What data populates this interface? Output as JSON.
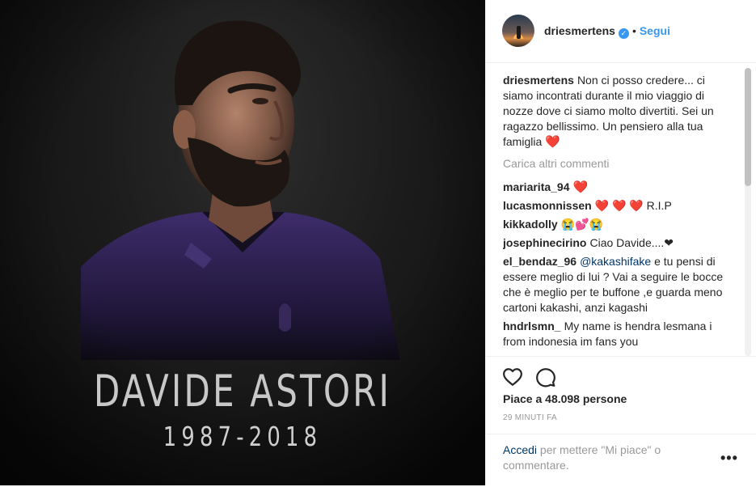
{
  "photo": {
    "name": "DAVIDE ASTORI",
    "years": "1987-2018"
  },
  "header": {
    "username": "driesmertens",
    "separator": "•",
    "follow_label": "Segui"
  },
  "caption": {
    "username": "driesmertens",
    "text": "Non ci posso credere... ci siamo incontrati durante il mio viaggio di nozze dove ci siamo molto divertiti. Sei un ragazzo bellissimo. Un pensiero alla tua famiglia",
    "emoji": "❤️"
  },
  "load_more_label": "Carica altri commenti",
  "comments": [
    {
      "username": "mariarita_94",
      "text": "❤️"
    },
    {
      "username": "lucasmonnissen",
      "text": "❤️ ❤️ ❤️ R.I.P"
    },
    {
      "username": "kikkadolly",
      "text": "😭💕😭"
    },
    {
      "username": "josephinecirino",
      "text": "Ciao Davide....❤"
    },
    {
      "username": "el_bendaz_96",
      "mention": "@kakashifake",
      "text": " e tu pensi di essere meglio di lui ? Vai a seguire le bocce che è meglio per te buffone ,e guarda meno cartoni kakashi, anzi kagashi"
    },
    {
      "username": "hndrlsmn_",
      "text": "My name is hendra lesmana i from indonesia im fans you"
    }
  ],
  "likes_text": "Piace a 48.098 persone",
  "time_text": "29 MINUTI FA",
  "footer": {
    "login_link": "Accedi",
    "login_text": " per mettere \"Mi piace\" o commentare.",
    "more_label": "•••"
  },
  "colors": {
    "accent": "#3897f0",
    "link": "#003569",
    "muted": "#999999",
    "heart": "#ed2b3d",
    "photo_bg": "#151515",
    "jersey": "#3b2a66"
  }
}
